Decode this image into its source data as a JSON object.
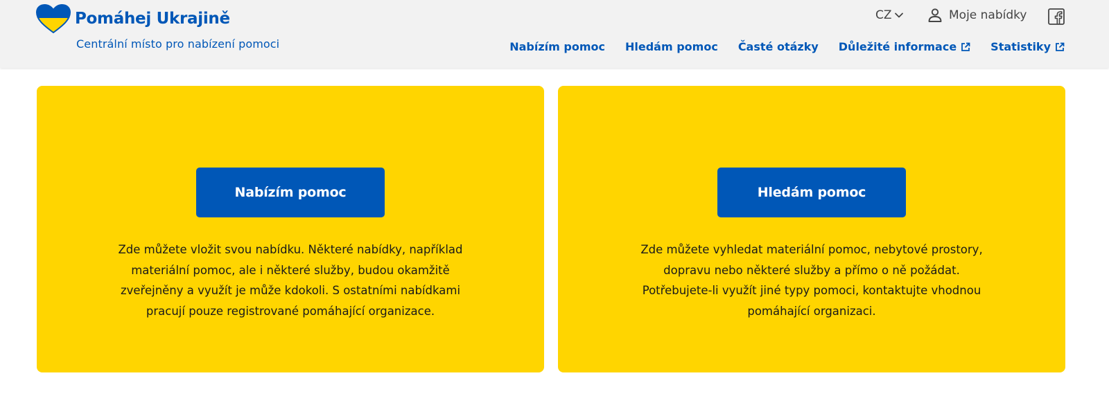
{
  "header": {
    "brand_title": "Pomáhej Ukrajině",
    "brand_subtitle": "Centrální místo pro nabízení pomoci",
    "brand_colors": {
      "blue": "#0057b7",
      "yellow": "#ffd500"
    },
    "language": "CZ",
    "account_label": "Moje nabídky",
    "icons": {
      "logo": "heart-flag-icon",
      "language_toggle": "chevron-down-icon",
      "account": "user-icon",
      "social": "facebook-icon",
      "external": "external-link-icon"
    }
  },
  "nav": {
    "items": [
      {
        "label": "Nabízím pomoc",
        "external": false
      },
      {
        "label": "Hledám pomoc",
        "external": false
      },
      {
        "label": "Časté otázky",
        "external": false
      },
      {
        "label": "Důležité informace",
        "external": true
      },
      {
        "label": "Statistiky",
        "external": true
      }
    ]
  },
  "cards": [
    {
      "button_label": "Nabízím pomoc",
      "text": "Zde můžete vložit svou nabídku. Některé nabídky, například materiální pomoc, ale i některé služby, budou okamžitě zveřejněny a využít je může kdokoli. S ostatními nabídkami pracují pouze registrované pomáhající organizace."
    },
    {
      "button_label": "Hledám pomoc",
      "text": "Zde můžete vyhledat materiální pomoc, nebytové prostory, dopravu nebo některé služby a přímo o ně požádat. Potřebujete-li využít jiné typy pomoci, kontaktujte vhodnou pomáhající organizaci."
    }
  ]
}
